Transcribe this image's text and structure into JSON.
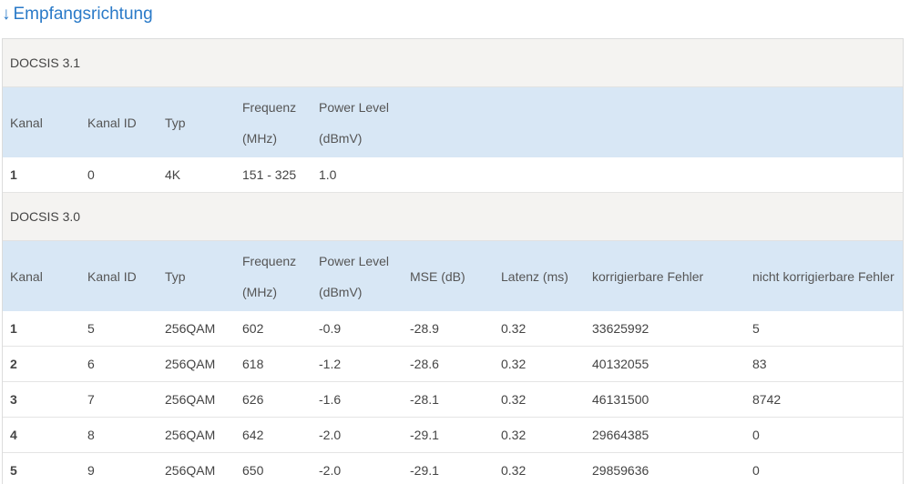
{
  "section": {
    "arrow": "↓",
    "title": "Empfangsrichtung"
  },
  "docsis31": {
    "title": "DOCSIS 3.1",
    "headers": {
      "kanal": "Kanal",
      "kanal_id": "Kanal ID",
      "typ": "Typ",
      "frequenz_1": "Frequenz",
      "frequenz_2": "(MHz)",
      "power_1": "Power Level",
      "power_2": "(dBmV)"
    },
    "rows": [
      {
        "kanal": "1",
        "kanal_id": "0",
        "typ": "4K",
        "frequenz": "151 - 325",
        "power": "1.0"
      }
    ]
  },
  "docsis30": {
    "title": "DOCSIS 3.0",
    "headers": {
      "kanal": "Kanal",
      "kanal_id": "Kanal ID",
      "typ": "Typ",
      "frequenz_1": "Frequenz",
      "frequenz_2": "(MHz)",
      "power_1": "Power Level",
      "power_2": "(dBmV)",
      "mse": "MSE (dB)",
      "latenz": "Latenz (ms)",
      "korr": "korrigierbare Fehler",
      "nkorr": "nicht korrigierbare Fehler"
    },
    "rows": [
      {
        "kanal": "1",
        "kanal_id": "5",
        "typ": "256QAM",
        "frequenz": "602",
        "power": "-0.9",
        "mse": "-28.9",
        "latenz": "0.32",
        "korr": "33625992",
        "nkorr": "5"
      },
      {
        "kanal": "2",
        "kanal_id": "6",
        "typ": "256QAM",
        "frequenz": "618",
        "power": "-1.2",
        "mse": "-28.6",
        "latenz": "0.32",
        "korr": "40132055",
        "nkorr": "83"
      },
      {
        "kanal": "3",
        "kanal_id": "7",
        "typ": "256QAM",
        "frequenz": "626",
        "power": "-1.6",
        "mse": "-28.1",
        "latenz": "0.32",
        "korr": "46131500",
        "nkorr": "8742"
      },
      {
        "kanal": "4",
        "kanal_id": "8",
        "typ": "256QAM",
        "frequenz": "642",
        "power": "-2.0",
        "mse": "-29.1",
        "latenz": "0.32",
        "korr": "29664385",
        "nkorr": "0"
      },
      {
        "kanal": "5",
        "kanal_id": "9",
        "typ": "256QAM",
        "frequenz": "650",
        "power": "-2.0",
        "mse": "-29.1",
        "latenz": "0.32",
        "korr": "29859636",
        "nkorr": "0"
      }
    ]
  }
}
